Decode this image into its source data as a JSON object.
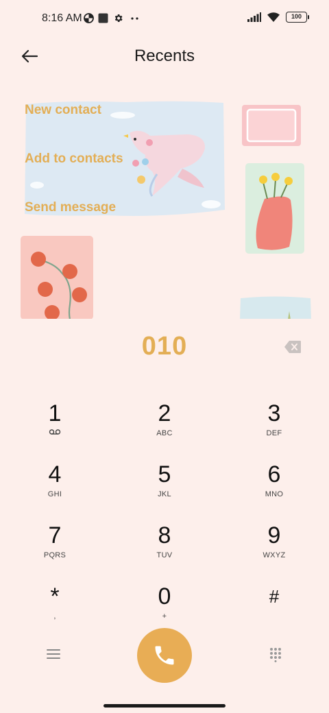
{
  "status_bar": {
    "time": "8:16 AM",
    "battery": "100"
  },
  "header": {
    "title": "Recents"
  },
  "menu": {
    "new_contact": "New contact",
    "add_to_contacts": "Add to contacts",
    "send_message": "Send message"
  },
  "dialer": {
    "number": "010"
  },
  "keypad": [
    {
      "num": "1",
      "sub": ""
    },
    {
      "num": "2",
      "sub": "ABC"
    },
    {
      "num": "3",
      "sub": "DEF"
    },
    {
      "num": "4",
      "sub": "GHI"
    },
    {
      "num": "5",
      "sub": "JKL"
    },
    {
      "num": "6",
      "sub": "MNO"
    },
    {
      "num": "7",
      "sub": "PQRS"
    },
    {
      "num": "8",
      "sub": "TUV"
    },
    {
      "num": "9",
      "sub": "WXYZ"
    },
    {
      "num": "*",
      "sub": ","
    },
    {
      "num": "0",
      "sub": "+"
    },
    {
      "num": "#",
      "sub": ""
    }
  ],
  "icons": {
    "back": "arrow-left-icon",
    "backspace": "backspace-icon",
    "voicemail": "voicemail-icon",
    "call": "phone-icon",
    "menu": "hamburger-icon",
    "dialpad": "dialpad-icon"
  },
  "colors": {
    "accent": "#e3ae55",
    "call_button": "#e8ad55",
    "background": "#fdefeb"
  }
}
